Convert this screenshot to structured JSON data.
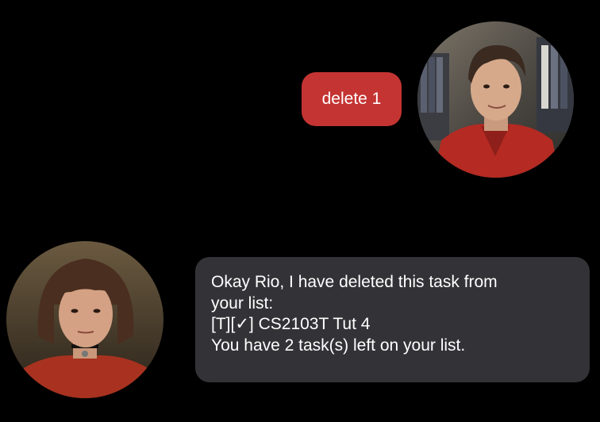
{
  "colors": {
    "background": "#000000",
    "user_bubble": "#c43432",
    "bot_bubble": "#333337",
    "text": "#ffffff"
  },
  "user": {
    "avatar_icon": "user-avatar-icon",
    "message": "delete 1"
  },
  "bot": {
    "avatar_icon": "bot-avatar-icon",
    "message_lines": [
      "Okay Rio, I have deleted this task from",
      "your list:",
      "[T][✓] CS2103T Tut 4",
      "You have 2 task(s) left on your list."
    ]
  }
}
